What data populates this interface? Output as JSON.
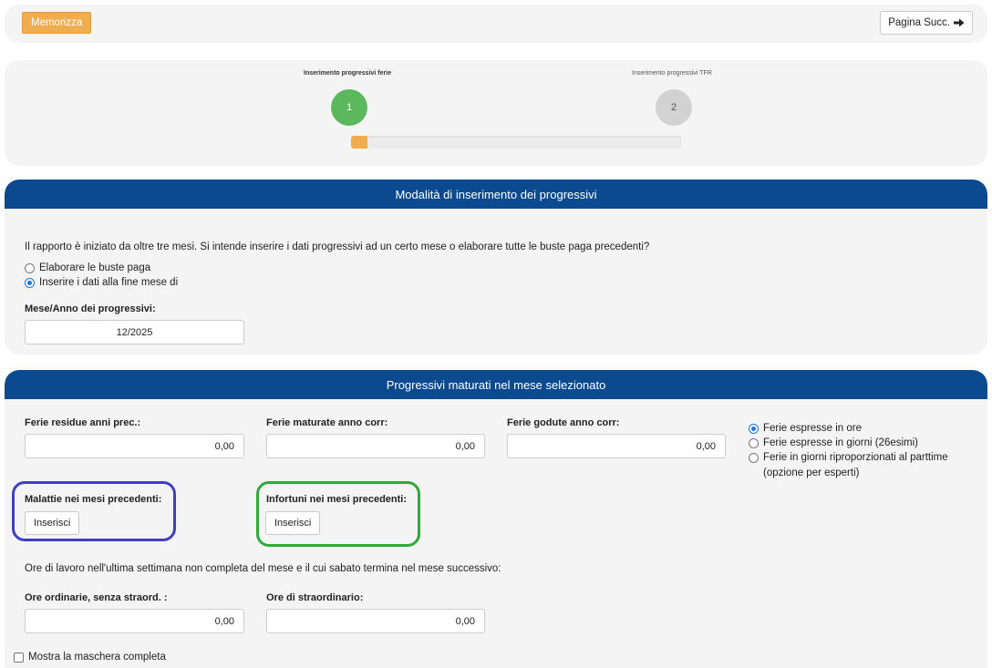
{
  "toolbar": {
    "save_label": "Memorizza",
    "next_label": "Pagina Succ."
  },
  "stepper": {
    "steps": [
      {
        "label": "Inserimento progressivi ferie",
        "number": "1",
        "active": true
      },
      {
        "label": "Inserimento progressivi TFR",
        "number": "2",
        "active": false
      }
    ],
    "progress_fraction": 0.05
  },
  "section1": {
    "title": "Modalità di inserimento dei progressivi",
    "question": "Il rapporto è iniziato da oltre tre mesi. Si intende inserire i dati progressivi ad un certo mese o elaborare tutte le buste paga precedenti?",
    "options": [
      {
        "label": "Elaborare le buste paga",
        "checked": false
      },
      {
        "label": "Inserire i dati alla fine mese di",
        "checked": true
      }
    ],
    "month_label": "Mese/Anno dei progressivi:",
    "month_value": "12/2025"
  },
  "section2": {
    "title": "Progressivi maturati nel mese selezionato",
    "ferie_residue_label": "Ferie residue anni prec.:",
    "ferie_residue_value": "0,00",
    "ferie_maturate_label": "Ferie maturate anno corr:",
    "ferie_maturate_value": "0,00",
    "ferie_godute_label": "Ferie godute anno corr:",
    "ferie_godute_value": "0,00",
    "units_options": [
      {
        "label": "Ferie espresse in ore",
        "checked": true
      },
      {
        "label": "Ferie espresse in giorni (26esimi)",
        "checked": false
      },
      {
        "label": "Ferie in giorni riproporzionati al parttime",
        "label2": "(opzione per esperti)",
        "checked": false
      }
    ],
    "malattie_label": "Malattie nei mesi precedenti:",
    "malattie_button": "Inserisci",
    "infortuni_label": "Infortuni nei mesi precedenti:",
    "infortuni_button": "Inserisci",
    "ore_note": "Ore di lavoro nell'ultima settimana non completa del mese e il cui sabato termina nel mese successivo:",
    "ore_ordinarie_label": "Ore ordinarie, senza straord. :",
    "ore_ordinarie_value": "0,00",
    "ore_straord_label": "Ore di straordinario:",
    "ore_straord_value": "0,00",
    "show_full_label": "Mostra la maschera completa"
  },
  "colors": {
    "accent": "#f0ad4e",
    "header": "#0c4a8f",
    "step_active": "#5cb85c",
    "highlight_blue": "#3f3fc4",
    "highlight_green": "#2eaa3a"
  }
}
